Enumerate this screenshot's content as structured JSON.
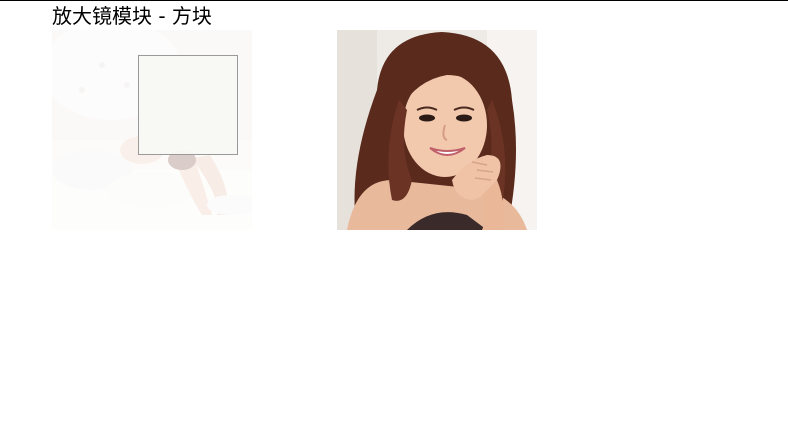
{
  "page": {
    "title": "放大镜模块 - 方块"
  },
  "thumbnail": {
    "icon": "faded-source-photo"
  },
  "lens": {
    "icon": "magnifier-square"
  },
  "preview": {
    "icon": "zoomed-portrait-photo"
  },
  "colors": {
    "lens_border": "#9a9a9a",
    "hair": "#5a2a1c",
    "skin": "#f2c9ad",
    "background_light": "#f4f1ee"
  }
}
